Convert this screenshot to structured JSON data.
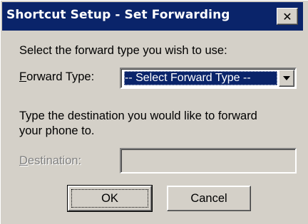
{
  "window": {
    "title": "Shortcut Setup - Set Forwarding",
    "close_glyph": "✕"
  },
  "instructions": {
    "forward_type_prompt": "Select the forward type you wish to use:",
    "destination_prompt_line1": "Type the destination you would like to forward",
    "destination_prompt_line2": "your phone to."
  },
  "forward_type": {
    "label_mnemonic": "F",
    "label_rest": "orward Type:",
    "selected_value": "-- Select Forward Type --"
  },
  "destination": {
    "label_mnemonic": "D",
    "label_rest": "estination:",
    "value": "",
    "enabled": false
  },
  "buttons": {
    "ok_label": "OK",
    "cancel_label": "Cancel"
  },
  "colors": {
    "title_bar": "#0a246a",
    "dialog_face": "#d4d0c8",
    "selection": "#0a246a"
  },
  "icons": {
    "close": "close-icon",
    "dropdown": "chevron-down-icon"
  }
}
